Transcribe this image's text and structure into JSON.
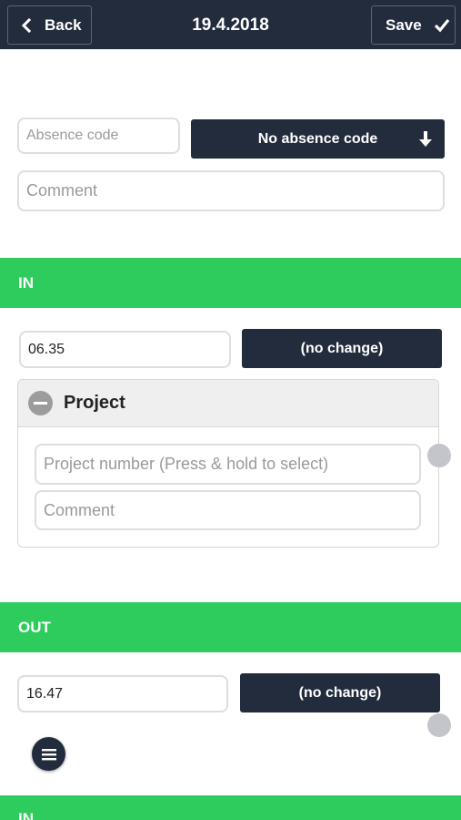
{
  "header": {
    "back_label": "Back",
    "title": "19.4.2018",
    "save_label": "Save"
  },
  "absence": {
    "code_placeholder": "Absence code",
    "dropdown_label": "No absence code",
    "comment_placeholder": "Comment"
  },
  "in_section": {
    "label": "IN",
    "time_value": "06.35",
    "change_label": "(no change)",
    "project": {
      "title": "Project",
      "number_placeholder": "Project number (Press & hold to select)",
      "comment_placeholder": "Comment"
    }
  },
  "out_section": {
    "label": "OUT",
    "time_value": "16.47",
    "change_label": "(no change)"
  },
  "next_section": {
    "label": "IN"
  },
  "colors": {
    "header": "#222c3d",
    "section_band": "#2dcc5c",
    "button_dark": "#222c3d"
  },
  "icons": {
    "back": "chevron-left-icon",
    "save": "checkmark-icon",
    "dropdown": "arrow-down-icon",
    "collapse": "minus-circle-icon",
    "menu": "hamburger-menu-icon"
  }
}
